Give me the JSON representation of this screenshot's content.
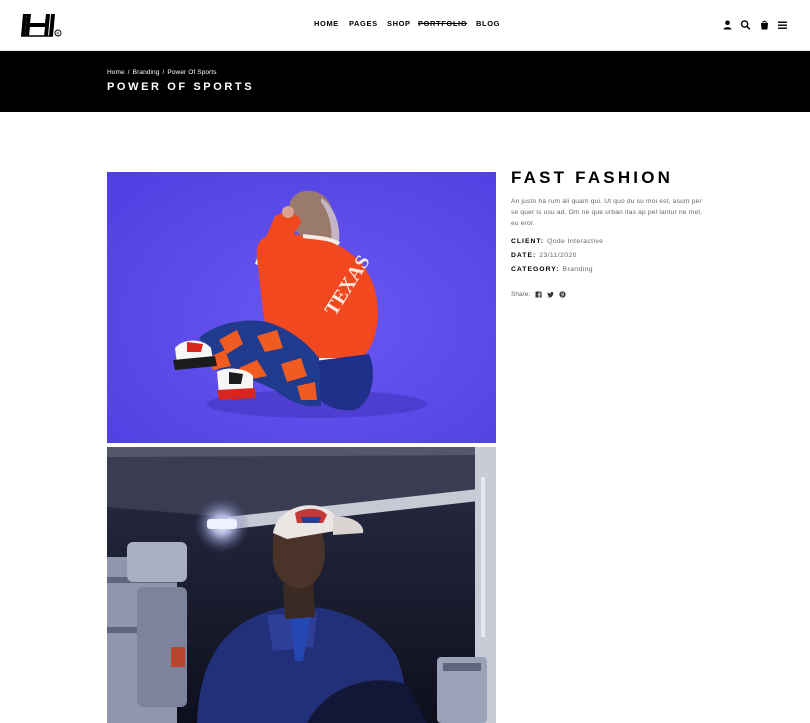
{
  "header": {
    "logo_label": "H",
    "nav": [
      {
        "label": "Home",
        "struck": false
      },
      {
        "label": "Pages",
        "struck": false
      },
      {
        "label": "Shop",
        "struck": false
      },
      {
        "label": "Portfolio",
        "struck": true
      },
      {
        "label": "Blog",
        "struck": false
      }
    ],
    "icons": [
      "user-icon",
      "search-icon",
      "cart-icon",
      "menu-icon"
    ]
  },
  "titlebar": {
    "breadcrumb": [
      "Home",
      "Branding",
      "Power Of Sports"
    ],
    "separator": "/",
    "title": "Power of Sports"
  },
  "project": {
    "title": "Fast Fashion",
    "description": "An justo ha rum ali quam qui. Ut quo du su moi est, asum per se quer is usu ad. Om ne que urban itas ap pel lantur ne mel, eu eror.",
    "meta": [
      {
        "label": "Client:",
        "value": "Qode Interactive"
      },
      {
        "label": "Date:",
        "value": "23/11/2020"
      },
      {
        "label": "Category:",
        "value": "Branding"
      }
    ],
    "share_label": "Share:",
    "share_icons": [
      "facebook-icon",
      "twitter-icon",
      "pinterest-icon"
    ],
    "jacket_text": "TEXAS"
  },
  "colors": {
    "background": "#ffffff",
    "titlebar": "#000000",
    "photo1_backdrop": "#5a48ea",
    "jacket": "#f2481f",
    "photo2_backdrop": "#1a1d36"
  }
}
